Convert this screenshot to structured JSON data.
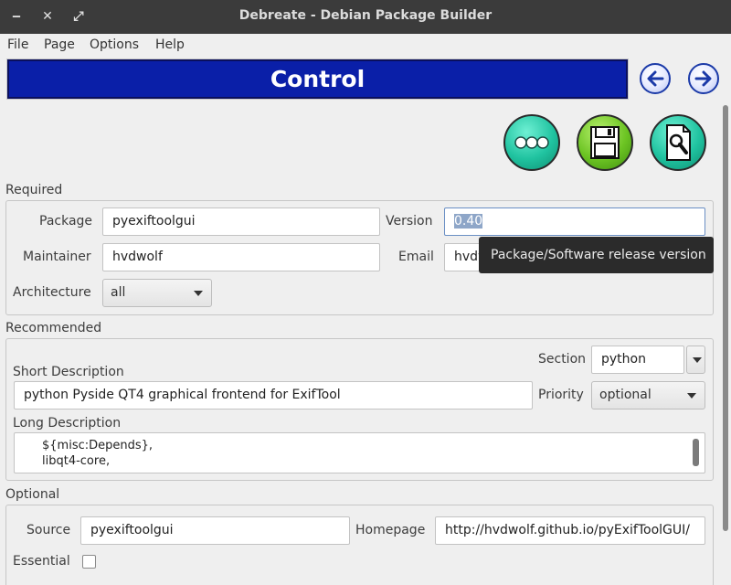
{
  "window": {
    "title": "Debreate - Debian Package Builder",
    "controls": {
      "minimize": "‒",
      "close": "✕",
      "maximize": "⤢"
    }
  },
  "menubar": {
    "items": [
      {
        "label": "File"
      },
      {
        "label": "Page"
      },
      {
        "label": "Options"
      },
      {
        "label": "Help"
      }
    ]
  },
  "page": {
    "title": "Control",
    "banner_color": "#0a1fa8"
  },
  "toolbar": {
    "buttons": [
      {
        "icon": "ellipsis-icon",
        "color": "#20c3a0"
      },
      {
        "icon": "floppy-save-icon",
        "color": "#6cc423"
      },
      {
        "icon": "document-preview-icon",
        "color": "#20c3a0"
      }
    ]
  },
  "required": {
    "section_label": "Required",
    "package": {
      "label": "Package",
      "value": "pyexiftoolgui"
    },
    "version": {
      "label": "Version",
      "value": "0.40"
    },
    "maintainer": {
      "label": "Maintainer",
      "value": "hvdwolf"
    },
    "email": {
      "label": "Email",
      "value": "hvdw"
    },
    "architecture": {
      "label": "Architecture",
      "value": "all"
    }
  },
  "tooltip": {
    "text": "Package/Software release version"
  },
  "recommended": {
    "section_label": "Recommended",
    "section": {
      "label": "Section",
      "value": "python"
    },
    "short_description": {
      "label": "Short Description",
      "value": "python Pyside QT4 graphical frontend for ExifTool"
    },
    "priority": {
      "label": "Priority",
      "value": "optional"
    },
    "long_description": {
      "label": "Long Description",
      "value": "${misc:Depends},\nlibqt4-core,"
    }
  },
  "optional": {
    "section_label": "Optional",
    "source": {
      "label": "Source",
      "value": "pyexiftoolgui"
    },
    "homepage": {
      "label": "Homepage",
      "value": "http://hvdwolf.github.io/pyExifToolGUI/"
    },
    "essential": {
      "label": "Essential",
      "checked": false
    }
  }
}
